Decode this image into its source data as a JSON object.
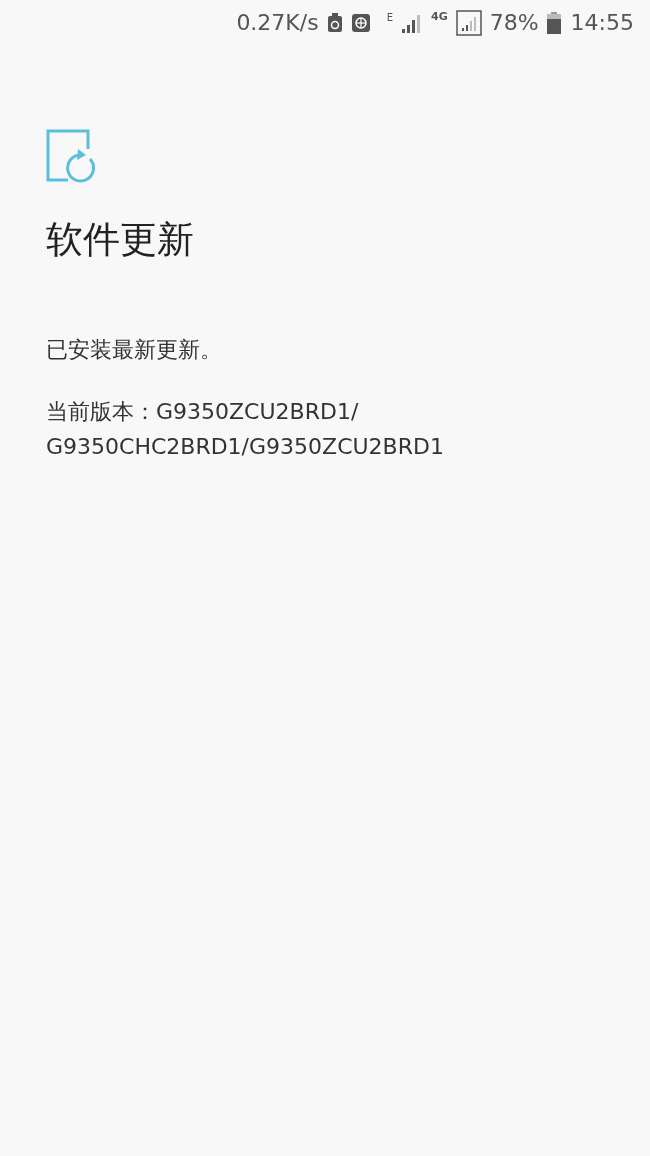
{
  "status_bar": {
    "speed": "0.27K/s",
    "network_type": "E",
    "data_type": "4G",
    "battery": "78%",
    "time": "14:55"
  },
  "title": "软件更新",
  "message": "已安装最新更新。",
  "version_lines": [
    "当前版本：G9350ZCU2BRD1/",
    "G9350CHC2BRD1/G9350ZCU2BRD1"
  ]
}
